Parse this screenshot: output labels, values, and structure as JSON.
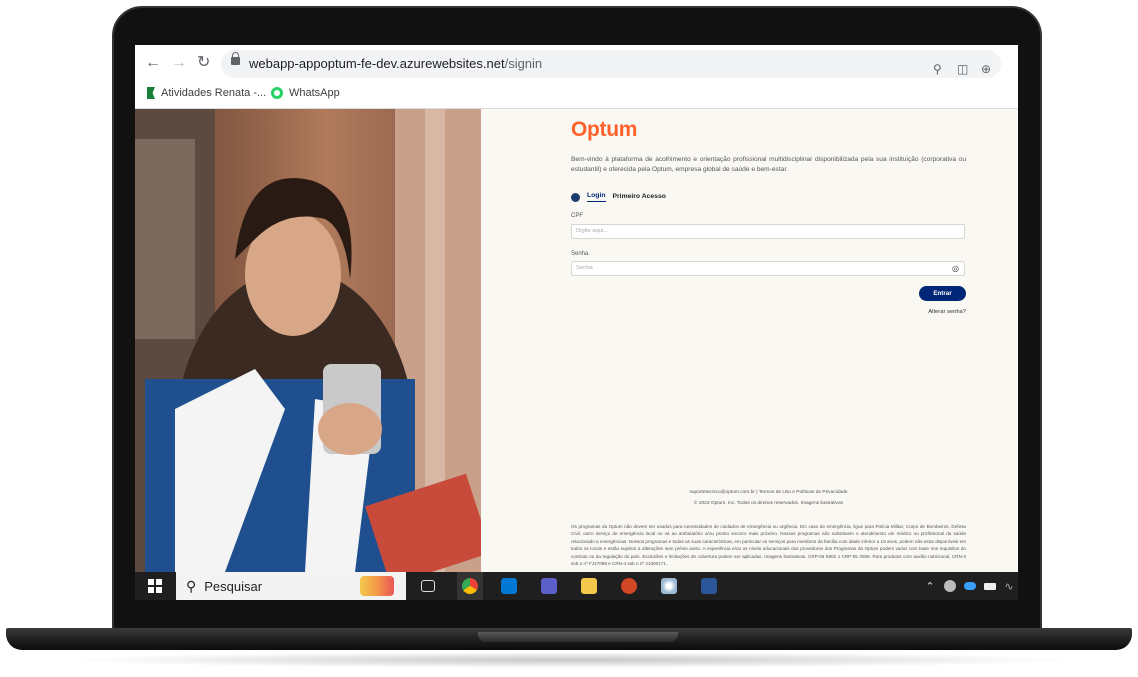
{
  "browser": {
    "url_host": "webapp-appoptum-fe-dev.azurewebsites.net",
    "url_path": "/signin",
    "bookmarks": [
      {
        "label": "Atividades Renata -..."
      },
      {
        "label": "WhatsApp"
      }
    ]
  },
  "page": {
    "logo": "Optum",
    "intro": "Bem-vindo à plataforma de acolhimento e orientação profissional multidisciplinar disponibilizada pela sua instituição (corporativa ou estudantil) e oferecida pela Optum, empresa global de saúde e bem-estar.",
    "tabs": [
      {
        "label": "Login",
        "active": true
      },
      {
        "label": "Primeiro Acesso",
        "active": false
      }
    ],
    "cpf_label": "CPF",
    "cpf_placeholder": "Digite aqui...",
    "password_label": "Senha",
    "password_placeholder": "Senha",
    "submit_label": "Entrar",
    "change_password": "Alterar senha?",
    "footer_links": "suportetecnico@optum.com.br | Termos de Uso e Políticas de Privacidade",
    "copyright": "© 2023 Optum, Inc. Todos os direitos reservados. Imagens ilustrativas",
    "disclaimer": "Os programas da Optum não devem ser usados para necessidades de cuidados de emergência ou urgência. Em caso de emergência, ligue para Polícia Militar, Corpo de Bombeiros, Defesa Civil, outro serviço de emergência local ou vá ao ambulatório a/ou pronto socorro mais próximo. Nossos programas não substituem o atendimento um médico ou profissional da saúde relacionado a emergências. Nossos programas e todas as suas características, em particular os serviços para membros da família com idade inferior a 18 anos, podem não estar disponíveis em todos os locais e estão sujeitos a alterações sem prévio aviso. A experiência e/ou os níveis educacionais dos provedores dos Programas da Optum podem variar com base nos requisitos do contrato ou da regulação do país. Exclusões e limitações de cobertura podem ser aplicadas. Imagens ilustrativas. CRP-06 5802 J CRP-05 2596. Para produtos com auxílio nutricional, CRN-3 sob o nº FJ17098 e CRN-4 sob o nº 21000171."
  },
  "taskbar": {
    "search_placeholder": "Pesquisar"
  },
  "colors": {
    "brand_orange": "#ff612b",
    "brand_navy": "#002677",
    "pane_bg": "#faf8f2"
  }
}
